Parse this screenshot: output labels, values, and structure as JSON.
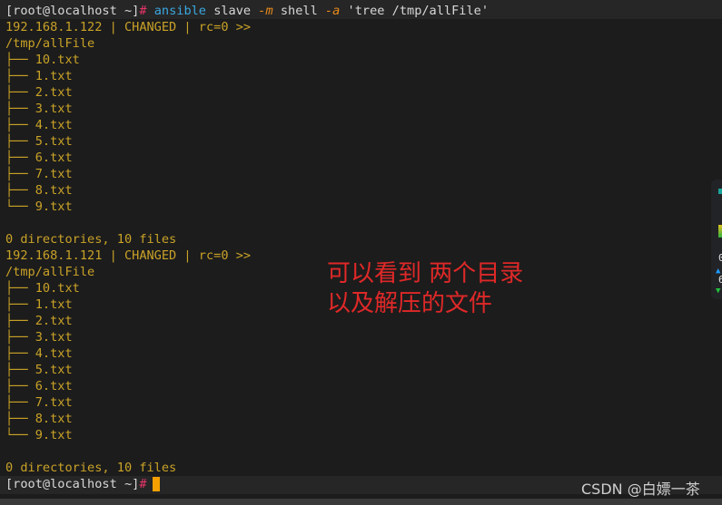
{
  "prompt": {
    "user_host": "[root@localhost ~]",
    "symbol": "#"
  },
  "command": {
    "program": "ansible",
    "host_group": "slave",
    "module_flag": "-m",
    "module": "shell",
    "args_flag": "-a",
    "args": "'tree /tmp/allFile'"
  },
  "hosts": [
    {
      "header": "192.168.1.122 | CHANGED | rc=0 >>",
      "root": "/tmp/allFile",
      "entries": [
        "├── 10.txt",
        "├── 1.txt",
        "├── 2.txt",
        "├── 3.txt",
        "├── 4.txt",
        "├── 5.txt",
        "├── 6.txt",
        "├── 7.txt",
        "├── 8.txt",
        "└── 9.txt"
      ],
      "summary": "0 directories, 10 files"
    },
    {
      "header": "192.168.1.121 | CHANGED | rc=0 >>",
      "root": "/tmp/allFile",
      "entries": [
        "├── 10.txt",
        "├── 1.txt",
        "├── 2.txt",
        "├── 3.txt",
        "├── 4.txt",
        "├── 5.txt",
        "├── 6.txt",
        "├── 7.txt",
        "├── 8.txt",
        "└── 9.txt"
      ],
      "summary": "0 directories, 10 files"
    }
  ],
  "annotation": {
    "line1": "可以看到  两个目录",
    "line2": "以及解压的文件",
    "color": "#e02828"
  },
  "watermark": "CSDN @白嫖一茶",
  "side_panel": {
    "val1": "0",
    "val2": "6"
  },
  "colors": {
    "background": "#1c1c1c",
    "output": "#c9a227",
    "command": "#3aa8e0",
    "prompt_symbol": "#e8356a",
    "cursor": "#f5a000"
  }
}
